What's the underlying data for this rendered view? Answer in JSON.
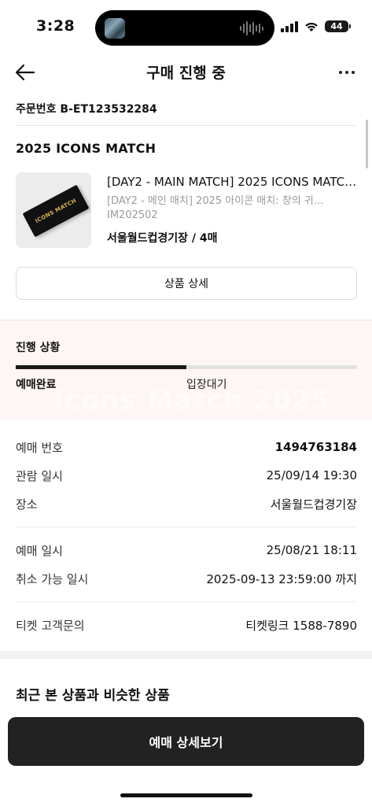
{
  "status_bar": {
    "time": "3:28",
    "battery": "44"
  },
  "header": {
    "title": "구매 진행 중"
  },
  "order": {
    "number_label": "주문번호 B-ET123532284"
  },
  "event": {
    "title": "2025 ICONS MATCH"
  },
  "product": {
    "name": "[DAY2 - MAIN MATCH] 2025 ICONS MATCH: ...",
    "subtitle": "[DAY2 - 메인 매치] 2025 아이콘 매치: 창의 귀...",
    "code": "IM202502",
    "venue_qty": "서울월드컵경기장 / 4매",
    "ticket_text": "ICONS MATCH",
    "detail_button": "상품 상세"
  },
  "progress": {
    "title": "진행 상황",
    "percent": 50,
    "steps": [
      "예매완료",
      "입장대기"
    ],
    "watermark": "Icons Match 2025"
  },
  "info": {
    "booking_no_label": "예매 번호",
    "booking_no": "1494763184",
    "viewing_label": "관람 일시",
    "viewing": "25/09/14 19:30",
    "venue_label": "장소",
    "venue": "서울월드컵경기장",
    "booking_date_label": "예매 일시",
    "booking_date": "25/08/21 18:11",
    "cancel_label": "취소 가능 일시",
    "cancel": "2025-09-13 23:59:00 까지",
    "inquiry_label": "티켓 고객문의",
    "inquiry": "티켓링크 1588-7890"
  },
  "recent": {
    "title": "최근 본 상품과 비슷한 상품"
  },
  "cta": {
    "label": "예매 상세보기"
  }
}
